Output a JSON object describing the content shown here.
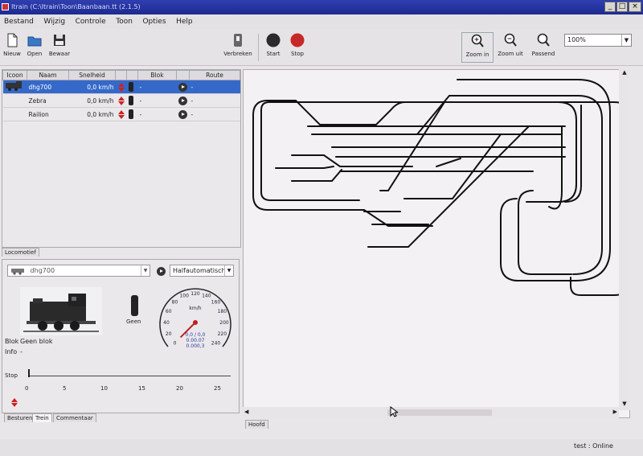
{
  "window": {
    "title": "Itrain (C:\\Itrain\\Toon\\Baanbaan.tt (2.1.5)",
    "minimize": "_",
    "maximize": "□",
    "close": "×"
  },
  "menu": [
    "Bestand",
    "Wijzig",
    "Controle",
    "Toon",
    "Opties",
    "Help"
  ],
  "toolbar": {
    "new_label": "Nieuw",
    "open_label": "Open",
    "save_label": "Bewaar",
    "disconnect_label": "Verbreken",
    "start_label": "Start",
    "stop_label": "Stop",
    "zoom_in_label": "Zoom in",
    "zoom_out_label": "Zoom uit",
    "fit_label": "Passend",
    "zoom_value": "100%"
  },
  "loco_table": {
    "headers": [
      "Icoon",
      "Naam",
      "Snelheid",
      "",
      "",
      "Blok",
      "",
      "Route"
    ],
    "rows": [
      {
        "name": "dhg700",
        "speed": "0,0 km/h",
        "block": "-",
        "route": "-"
      },
      {
        "name": "Zebra",
        "speed": "0,0 km/h",
        "block": "-",
        "route": "-"
      },
      {
        "name": "Railion",
        "speed": "0,0 km/h",
        "block": "-",
        "route": "-"
      }
    ]
  },
  "loco_tab": "Locomotief",
  "control": {
    "loco_select": "dhg700",
    "mode_select": "Halfautomatisch",
    "signal_label": "Geen",
    "blok_label": "Blok",
    "blok_value": "Geen blok",
    "info_label": "Info",
    "info_value": "-",
    "stop_label": "Stop",
    "unit": "km/h",
    "readout": [
      "0,0 / 0,0",
      "0.00.07",
      "0.000,3"
    ],
    "scale_ticks": [
      "0",
      "5",
      "10",
      "15",
      "20",
      "25"
    ],
    "gauge_ticks": [
      "0",
      "20",
      "40",
      "60",
      "80",
      "100",
      "120",
      "140",
      "160",
      "180",
      "200",
      "220",
      "240"
    ],
    "speed_value": 0
  },
  "bottom_tabs": [
    "Besturen",
    "Trein",
    "Commentaar"
  ],
  "canvas_tab": "Hoofd",
  "status": {
    "text": "test : Online"
  },
  "colors": {
    "titlebar": "#1c2a8f",
    "selection": "#3569c9",
    "track": "#111111",
    "stop": "#c62828",
    "start": "#2b2b2b"
  }
}
